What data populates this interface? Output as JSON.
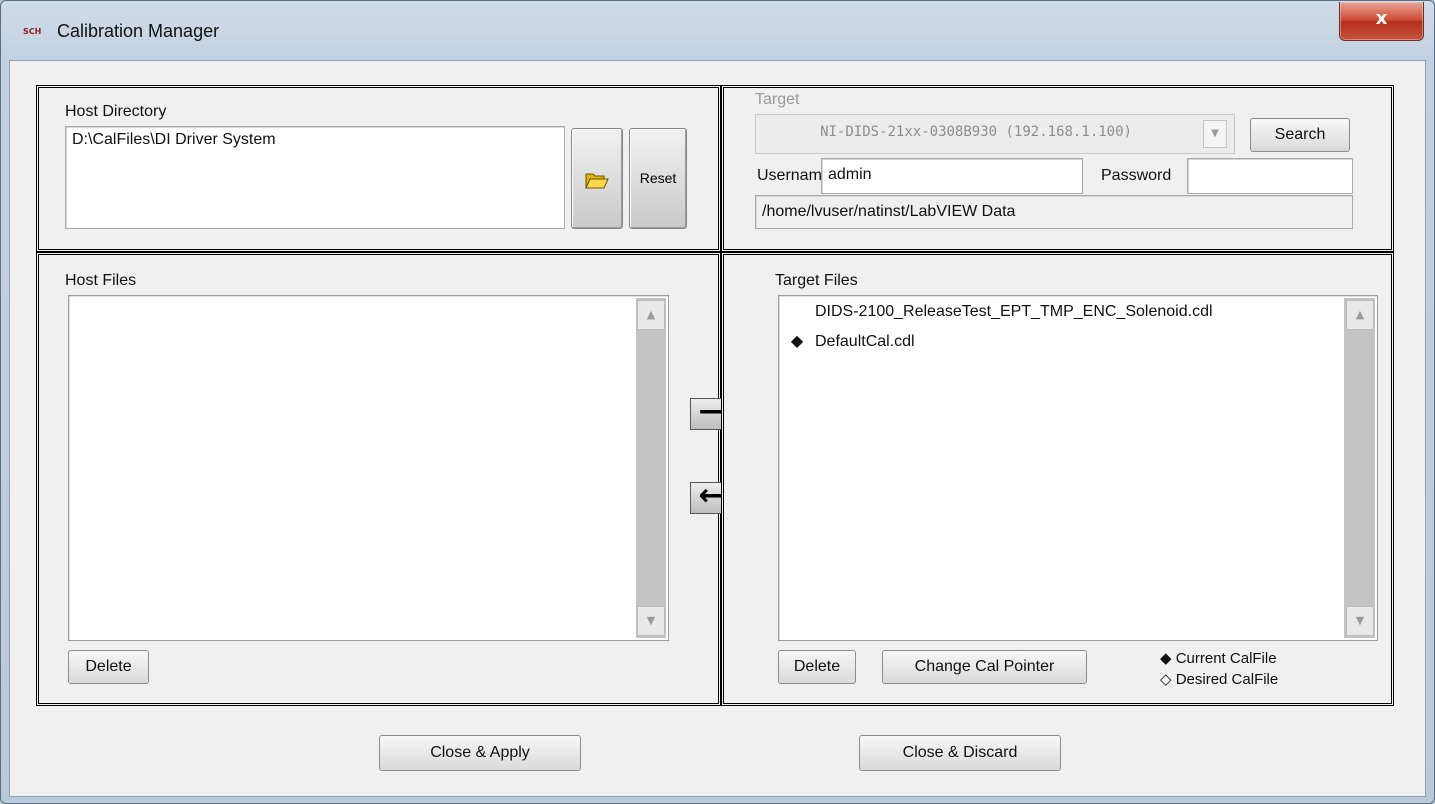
{
  "window": {
    "title": "Calibration Manager",
    "app_icon_text": "SCH",
    "close_label": "x"
  },
  "host_directory": {
    "label": "Host Directory",
    "path": "D:\\CalFiles\\DI Driver System",
    "browse_icon": "folder-open-icon",
    "reset_label": "Reset"
  },
  "target": {
    "label": "Target",
    "selected": "NI-DIDS-21xx-0308B930 (192.168.1.100)",
    "search_label": "Search",
    "username_label": "Username",
    "username_value": "admin",
    "password_label": "Password",
    "password_value": "",
    "remote_path": "/home/lvuser/natinst/LabVIEW Data"
  },
  "host_files": {
    "label": "Host Files",
    "items": [],
    "delete_label": "Delete"
  },
  "transfer": {
    "to_target": "⟶",
    "to_host": "⟵"
  },
  "target_files": {
    "label": "Target Files",
    "items": [
      {
        "marker": "",
        "name": "DIDS-2100_ReleaseTest_EPT_TMP_ENC_Solenoid.cdl"
      },
      {
        "marker": "◆",
        "name": "DefaultCal.cdl"
      }
    ],
    "delete_label": "Delete",
    "change_pointer_label": "Change Cal Pointer"
  },
  "legend": {
    "current": "◆ Current CalFile",
    "desired": "◇ Desired CalFile"
  },
  "footer": {
    "apply_label": "Close & Apply",
    "discard_label": "Close & Discard"
  }
}
